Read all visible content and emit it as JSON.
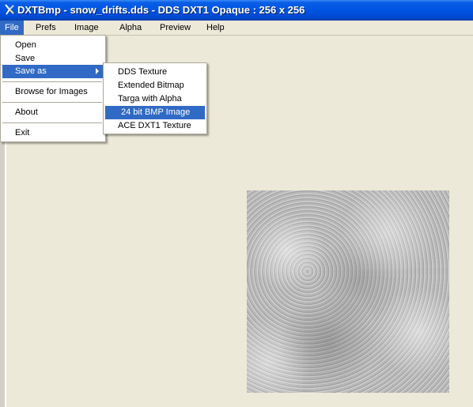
{
  "window": {
    "title": "DXTBmp - snow_drifts.dds - DDS DXT1 Opaque : 256 x 256",
    "icon": "dxtbmp-app-icon"
  },
  "menubar": {
    "items": [
      {
        "label": "File",
        "active": true
      },
      {
        "label": "Prefs"
      },
      {
        "label": "Image"
      },
      {
        "label": "Alpha"
      },
      {
        "label": "Preview"
      },
      {
        "label": "Help"
      }
    ]
  },
  "file_menu": {
    "open": "Open",
    "save": "Save",
    "save_as": "Save as",
    "browse": "Browse for Images",
    "about": "About",
    "exit": "Exit"
  },
  "saveas_menu": {
    "items": [
      "DDS Texture",
      "Extended Bitmap",
      "Targa with Alpha",
      "24 bit BMP Image",
      "ACE DXT1 Texture"
    ],
    "highlighted_index": 3
  },
  "colors": {
    "titlebar": "#0054e3",
    "menu_highlight": "#316ac5",
    "window_bg": "#ece9d8"
  }
}
